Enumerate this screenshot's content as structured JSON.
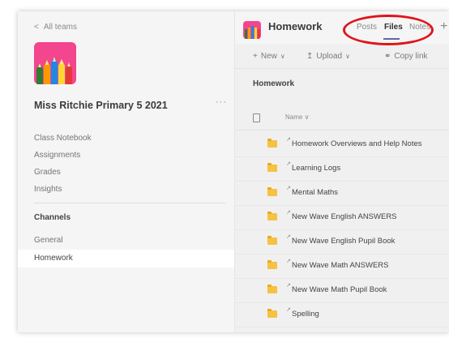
{
  "sidebar": {
    "back_label": "All teams",
    "team_name": "Miss Ritchie Primary 5 2021",
    "more_label": "···",
    "nav_items": [
      "Class Notebook",
      "Assignments",
      "Grades",
      "Insights"
    ],
    "channels_heading": "Channels",
    "channels": [
      "General",
      "Homework"
    ],
    "active_channel": "Homework"
  },
  "channel_header": {
    "title": "Homework",
    "tabs": [
      "Posts",
      "Files",
      "Notes"
    ],
    "active_tab": "Files",
    "add_tab": "+"
  },
  "toolbar": {
    "new_label": "New",
    "upload_label": "Upload",
    "copy_link_label": "Copy link"
  },
  "breadcrumb": "Homework",
  "files": {
    "name_header": "Name",
    "rows": [
      "Homework Overviews and Help Notes",
      "Learning Logs",
      "Mental Maths",
      "New Wave English ANSWERS",
      "New Wave English Pupil Book",
      "New Wave Math ANSWERS",
      "New Wave Math Pupil Book",
      "Spelling"
    ]
  },
  "colors": {
    "team_logo_bg": "#f4458f",
    "highlight": "#e0141a",
    "folder": "#f5c242",
    "accent": "#6264a7"
  }
}
